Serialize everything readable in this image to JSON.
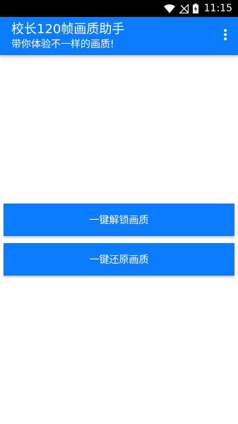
{
  "status_bar": {
    "time": "11:15",
    "icons": [
      "wifi-icon",
      "no-signal-icon",
      "battery-charging-icon"
    ]
  },
  "app_bar": {
    "title": "校长120帧画质助手",
    "subtitle": "带你体验不一样的画质!",
    "menu_icon": "more-vert-icon",
    "color": "#0b7bff"
  },
  "buttons": [
    {
      "label": "一键解锁画质"
    },
    {
      "label": "一键还原画质"
    }
  ],
  "colors": {
    "accent": "#0b7bff",
    "status_bar": "#000000",
    "background": "#ffffff"
  }
}
